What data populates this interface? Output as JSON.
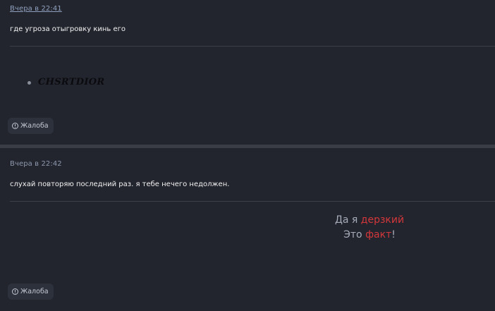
{
  "posts": [
    {
      "timestamp": "Вчера в 22:41",
      "message": "где угроза отыгровку кинь его",
      "signature": {
        "items": [
          "CHSRTDIOR"
        ]
      },
      "report_label": "Жалоба",
      "report_icon": "info-icon"
    },
    {
      "timestamp": "Вчера в 22:42",
      "message": "слухай повторяю последний раз. я тебе нечего недолжен.",
      "signature": {
        "line1_prefix": "Да я ",
        "line1_highlight": "дерзкий",
        "line2_prefix": "Это ",
        "line2_highlight": "факт",
        "line2_suffix": "!",
        "highlight_color": "#d4373b"
      },
      "report_label": "Жалоба",
      "report_icon": "info-icon"
    }
  ]
}
